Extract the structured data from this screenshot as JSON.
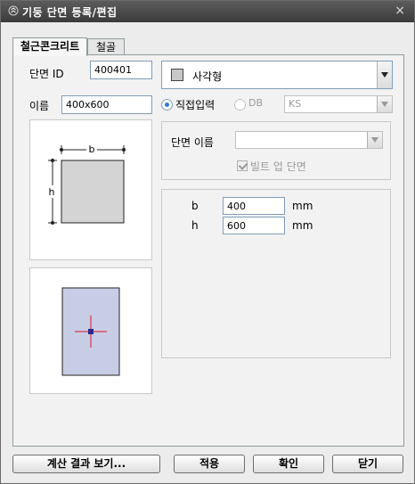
{
  "window": {
    "title": "기둥 단면 등록/편집",
    "close_glyph": "×"
  },
  "tabs": [
    {
      "label": "철근콘크리트"
    },
    {
      "label": "철골"
    }
  ],
  "section_id": {
    "label": "단면 ID",
    "value": "400401"
  },
  "name": {
    "label": "이름",
    "value": "400x600"
  },
  "shape_combo": {
    "value": "사각형",
    "swatch_color": "#c8c8c8"
  },
  "input_mode": {
    "direct_label": "직접입력",
    "db_label": "DB",
    "db_value": "KS"
  },
  "section_name": {
    "label": "단면 이름",
    "value": ""
  },
  "built_up": {
    "label": "빌트 업 단면"
  },
  "dims": [
    {
      "label": "b",
      "value": "400",
      "unit": "mm"
    },
    {
      "label": "h",
      "value": "600",
      "unit": "mm"
    }
  ],
  "diagram": {
    "b_label": "b",
    "h_label": "h",
    "fill_color": "#d4d4d4"
  },
  "preview": {
    "section_color": "#c8cde6",
    "cross_color": "#e0142c",
    "marker_color": "#2a2a8a"
  },
  "buttons": {
    "calc": "계산 결과 보기...",
    "apply": "적용",
    "ok": "확인",
    "close": "닫기"
  }
}
